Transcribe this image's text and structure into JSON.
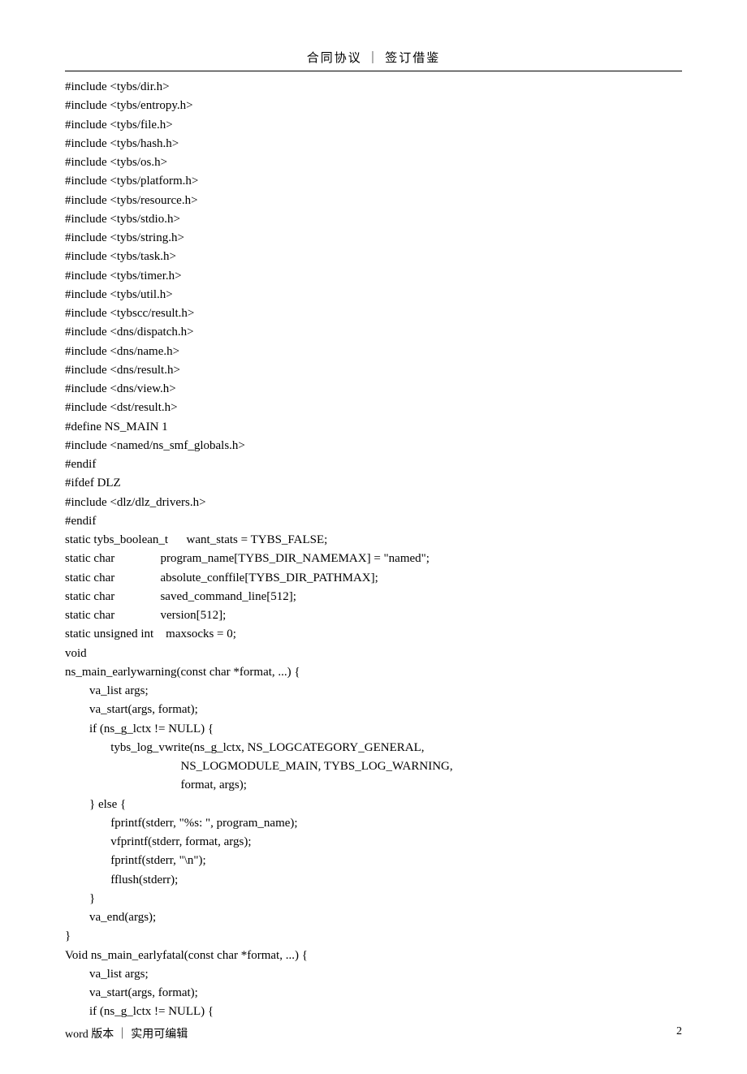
{
  "header": "合同协议 ｜ 签订借鉴",
  "code": "#include <tybs/dir.h>\n#include <tybs/entropy.h>\n#include <tybs/file.h>\n#include <tybs/hash.h>\n#include <tybs/os.h>\n#include <tybs/platform.h>\n#include <tybs/resource.h>\n#include <tybs/stdio.h>\n#include <tybs/string.h>\n#include <tybs/task.h>\n#include <tybs/timer.h>\n#include <tybs/util.h>\n#include <tybscc/result.h>\n#include <dns/dispatch.h>\n#include <dns/name.h>\n#include <dns/result.h>\n#include <dns/view.h>\n#include <dst/result.h>\n#define NS_MAIN 1\n#include <named/ns_smf_globals.h>\n#endif\n#ifdef DLZ\n#include <dlz/dlz_drivers.h>\n#endif\nstatic tybs_boolean_t      want_stats = TYBS_FALSE;\nstatic char               program_name[TYBS_DIR_NAMEMAX] = \"named\";\nstatic char               absolute_conffile[TYBS_DIR_PATHMAX];\nstatic char               saved_command_line[512];\nstatic char               version[512];\nstatic unsigned int    maxsocks = 0;\nvoid\nns_main_earlywarning(const char *format, ...) {\n        va_list args;\n        va_start(args, format);\n        if (ns_g_lctx != NULL) {\n               tybs_log_vwrite(ns_g_lctx, NS_LOGCATEGORY_GENERAL,\n                                      NS_LOGMODULE_MAIN, TYBS_LOG_WARNING,\n                                      format, args);\n        } else {\n               fprintf(stderr, \"%s: \", program_name);\n               vfprintf(stderr, format, args);\n               fprintf(stderr, \"\\n\");\n               fflush(stderr);\n        }\n        va_end(args);\n}\nVoid ns_main_earlyfatal(const char *format, ...) {\n        va_list args;\n        va_start(args, format);\n        if (ns_g_lctx != NULL) {",
  "footer_left": "word 版本 ｜ 实用可编辑",
  "footer_right": "2"
}
